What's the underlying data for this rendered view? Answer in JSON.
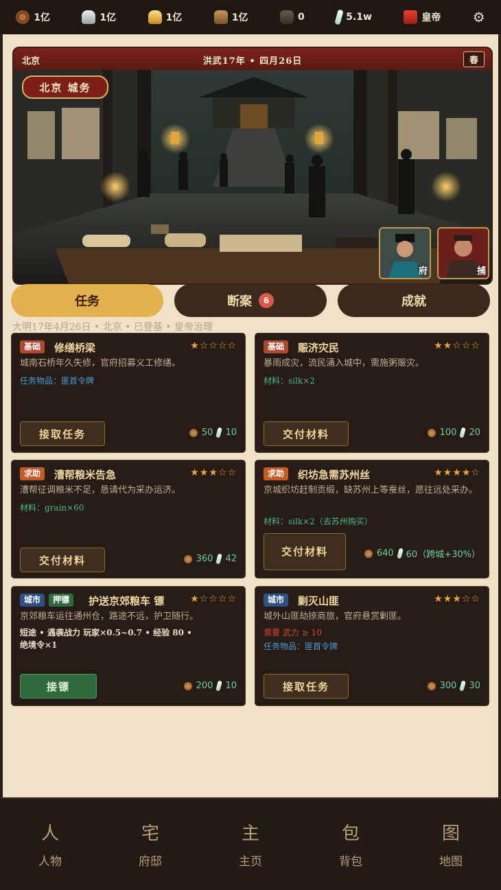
{
  "resources": [
    {
      "icon": "copper-coin-icon",
      "value": "1亿"
    },
    {
      "icon": "silver-ingot-icon",
      "value": "1亿"
    },
    {
      "icon": "gold-ingot-icon",
      "value": "1亿"
    },
    {
      "icon": "grain-sack-icon",
      "value": "1亿"
    },
    {
      "icon": "ore-icon",
      "value": "0"
    },
    {
      "icon": "jade-icon",
      "value": "5.1w"
    },
    {
      "icon": "emperor-seal-icon",
      "value": "皇帝"
    }
  ],
  "banner": {
    "city": "北京",
    "date": "洪武17年 • 四月26日",
    "season": "春",
    "badge": "北京 城务",
    "portraits": [
      {
        "tag": "府"
      },
      {
        "tag": "捕"
      }
    ]
  },
  "tabs": [
    {
      "label": "任务",
      "active": true
    },
    {
      "label": "断案",
      "badge": "6"
    },
    {
      "label": "成就"
    }
  ],
  "info_line": "大明17年4月26日 • 北京 • 已登基 • 皇帝治理",
  "cards": [
    {
      "tags": [
        "基础"
      ],
      "title": "修缮桥梁",
      "stars": "★☆☆☆☆",
      "desc": "城南石桥年久失修，官府招募义工修缮。",
      "lines": [
        {
          "text": "任务物品：匪首令牌",
          "color": "blue"
        }
      ],
      "button": "接取任务",
      "coins": "50",
      "jade": "10"
    },
    {
      "tags": [
        "基础"
      ],
      "title": "赈济灾民",
      "stars": "★★☆☆☆",
      "desc": "暴雨成灾，流民涌入城中，需施粥赈灾。",
      "lines": [
        {
          "text": "材料：silk×2",
          "color": "green"
        }
      ],
      "button": "交付材料",
      "coins": "100",
      "jade": "20"
    },
    {
      "tags": [
        "求助"
      ],
      "title": "漕帮粮米告急",
      "stars": "★★★☆☆",
      "desc": "漕帮征调粮米不足，恳请代为采办运济。",
      "lines": [
        {
          "text": "材料：grain×60",
          "color": "green"
        }
      ],
      "button": "交付材料",
      "coins": "360",
      "jade": "42"
    },
    {
      "tags": [
        "求助"
      ],
      "title": "织坊急需苏州丝",
      "stars": "★★★★☆",
      "desc": "京城织坊赶制贡缎，缺苏州上等蚕丝，愿往远处采办。",
      "lines": [
        {
          "text": "材料：silk×2（去苏州购买）",
          "color": "green"
        }
      ],
      "button": "交付材料",
      "coins": "640",
      "jade": "60（跨城+30%）"
    },
    {
      "tags": [
        "城市",
        "押镖"
      ],
      "title": "护送京郊粮车 镖",
      "stars": "★☆☆☆☆",
      "desc": "京郊粮车运往通州仓，路途不远，护卫随行。",
      "lines": [
        {
          "text": "短途 • 遇袭战力 玩家×0.5~0.7 • 经验 80 •",
          "color": "white"
        },
        {
          "text": "绝境令×1",
          "color": "white"
        }
      ],
      "button": "接镖",
      "coins": "200",
      "jade": "10"
    },
    {
      "tags": [
        "城市"
      ],
      "title": "剿灭山匪",
      "stars": "★★★☆☆",
      "desc": "城外山匪劫掠商旅，官府悬赏剿匪。",
      "lines": [
        {
          "text": "需要 武力 ≥ 10",
          "color": "red"
        },
        {
          "text": "任务物品：匪首令牌",
          "color": "blue"
        }
      ],
      "button": "接取任务",
      "coins": "300",
      "jade": "30"
    }
  ],
  "nav": [
    {
      "icon": "人",
      "label": "人物"
    },
    {
      "icon": "宅",
      "label": "府邸"
    },
    {
      "icon": "主",
      "label": "主页"
    },
    {
      "icon": "包",
      "label": "背包"
    },
    {
      "icon": "图",
      "label": "地图"
    }
  ]
}
